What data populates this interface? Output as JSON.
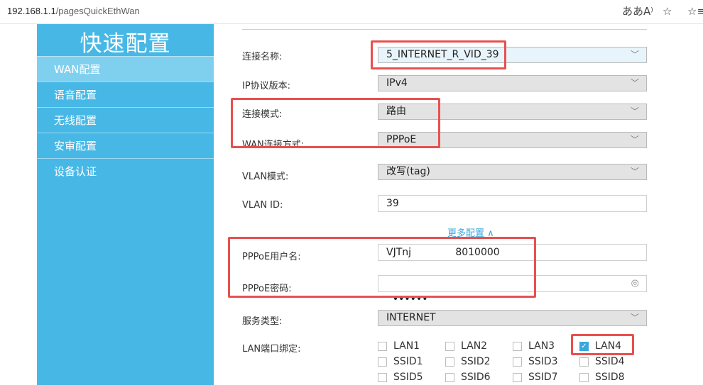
{
  "browser": {
    "url_host": "192.168.1.1",
    "url_path": "/pagesQuickEthWan"
  },
  "sidebar": {
    "title": "快速配置",
    "items": [
      {
        "label": "WAN配置",
        "active": true
      },
      {
        "label": "语音配置"
      },
      {
        "label": "无线配置"
      },
      {
        "label": "安审配置"
      },
      {
        "label": "设备认证"
      }
    ]
  },
  "form": {
    "connection_name": {
      "label": "连接名称:",
      "value": "5_INTERNET_R_VID_39"
    },
    "ip_version": {
      "label": "IP协议版本:",
      "value": "IPv4"
    },
    "connection_mode": {
      "label": "连接模式:",
      "value": "路由"
    },
    "wan_type": {
      "label": "WAN连接方式:",
      "value": "PPPoE"
    },
    "vlan_mode": {
      "label": "VLAN模式:",
      "value": "改写(tag)"
    },
    "vlan_id": {
      "label": "VLAN ID:",
      "value": "39"
    },
    "more_config": "更多配置 ∧",
    "pppoe_user": {
      "label": "PPPoE用户名:",
      "value": "VJTnj              8010000"
    },
    "pppoe_pass": {
      "label": "PPPoE密码:",
      "value": "••••••"
    },
    "service_type": {
      "label": "服务类型:",
      "value": "INTERNET"
    },
    "lan_binding": {
      "label": "LAN端口绑定:",
      "ports": [
        {
          "name": "LAN1",
          "checked": false
        },
        {
          "name": "LAN2",
          "checked": false
        },
        {
          "name": "LAN3",
          "checked": false
        },
        {
          "name": "LAN4",
          "checked": true
        },
        {
          "name": "SSID1",
          "checked": false
        },
        {
          "name": "SSID2",
          "checked": false
        },
        {
          "name": "SSID3",
          "checked": false
        },
        {
          "name": "SSID4",
          "checked": false
        },
        {
          "name": "SSID5",
          "checked": false
        },
        {
          "name": "SSID6",
          "checked": false
        },
        {
          "name": "SSID7",
          "checked": false
        },
        {
          "name": "SSID8",
          "checked": false
        }
      ]
    }
  },
  "colors": {
    "sidebar": "#47b8e6",
    "sidebar_active": "#7fd0ef",
    "accent": "#3aa7dc",
    "highlight": "#e8504f"
  }
}
